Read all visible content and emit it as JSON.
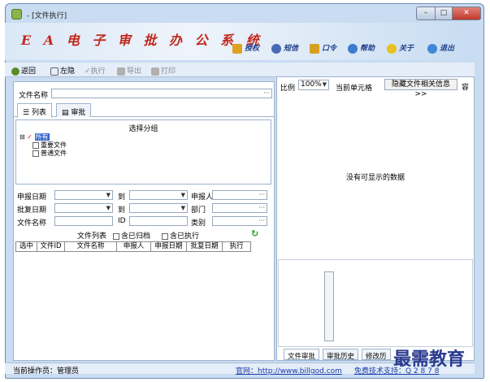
{
  "window": {
    "title": "- [文件执行]"
  },
  "banner": {
    "logo": "E A 电 子 审 批 办 公 系 统",
    "tools": [
      {
        "label": "授权",
        "icon": "key-icon",
        "color": "#e0a020"
      },
      {
        "label": "短信",
        "icon": "message-icon",
        "color": "#4a6ab0"
      },
      {
        "label": "口令",
        "icon": "lock-icon",
        "color": "#d8a020"
      },
      {
        "label": "帮助",
        "icon": "help-icon",
        "color": "#3d7ad0"
      },
      {
        "label": "关于",
        "icon": "about-icon",
        "color": "#e8c020"
      },
      {
        "label": "退出",
        "icon": "exit-icon",
        "color": "#3d88d8"
      }
    ]
  },
  "toolbar": {
    "back": "返回",
    "layout": "左隐",
    "execute": "执行",
    "export": "导出",
    "print": "打印"
  },
  "left": {
    "file_name_label": "文件名称",
    "tab_list": "列表",
    "tab_approve": "审批",
    "group_title": "选择分组",
    "tree_root": "所有",
    "tree_child1": "重要文件",
    "tree_child2": "普通文件",
    "filter": {
      "apply_date": "申报日期",
      "approve_date": "批复日期",
      "file_name": "文件名称",
      "to": "到",
      "applicant": "申报人",
      "dept": "部门",
      "category": "类别",
      "id": "ID"
    },
    "list_title": "文件列表",
    "archived": "含已归档",
    "executed": "含已执行",
    "columns": [
      "选中",
      "文件ID",
      "文件名称",
      "申报人",
      "申报日期",
      "批复日期",
      "执行"
    ]
  },
  "right": {
    "scale_label": "比例",
    "scale_value": "100%",
    "current_cell": "当前单元格",
    "hide_info": "隐藏文件相关信息 >>",
    "extra": "容",
    "empty_msg": "没有可显示的数据",
    "bottom_tabs": [
      "文件审批",
      "审批历史",
      "修改历"
    ]
  },
  "status": {
    "operator": "当前操作员：管理员",
    "website": "官网：http://www.billgod.com",
    "support": "免费技术支持：Q 2 8 7 8"
  },
  "watermark": "最需教育"
}
